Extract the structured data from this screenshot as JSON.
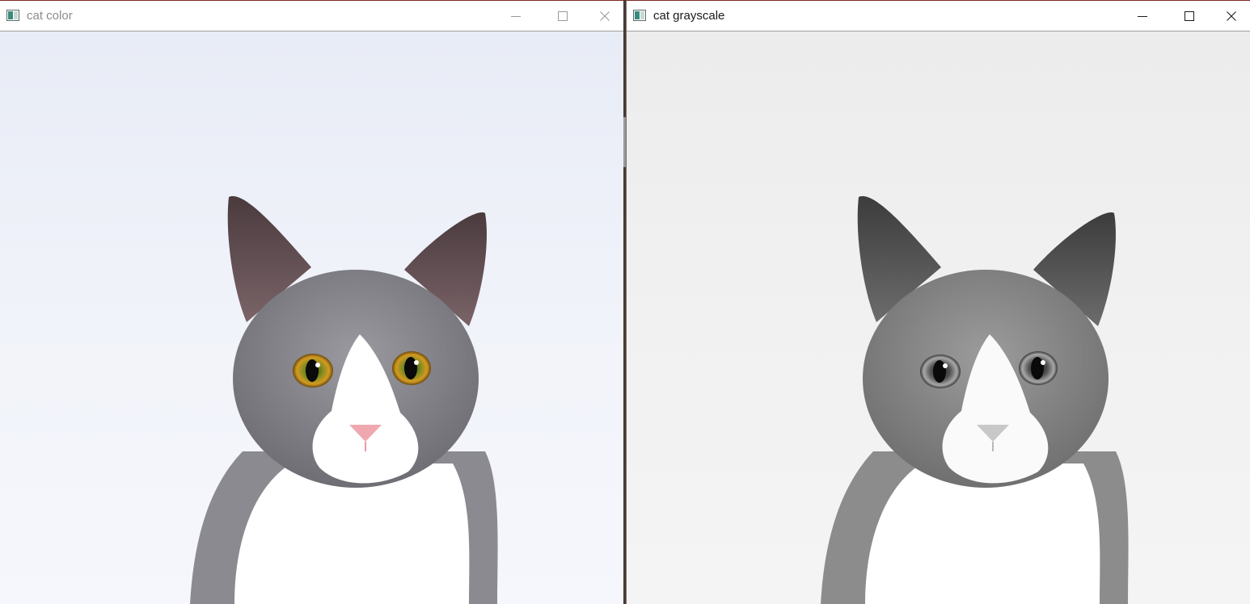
{
  "windows": [
    {
      "title": "cat color",
      "state": "inactive",
      "icon": "opencv-window-icon",
      "controls": [
        "minimize-icon",
        "maximize-icon",
        "close-icon"
      ],
      "image": "color photograph of a grey and white cat with orange-green eyes and pink nose on a pale blue-white background"
    },
    {
      "title": "cat grayscale",
      "state": "active",
      "icon": "opencv-window-icon",
      "controls": [
        "minimize-icon",
        "maximize-icon",
        "close-icon"
      ],
      "image": "grayscale version of the same cat photograph"
    }
  ],
  "colors": {
    "titlebar_bg": "#ffffff",
    "inactive_title": "#8c8c8c",
    "active_title": "#1a1a1a",
    "color_bg": "#eef1f8",
    "gray_bg": "#efefef"
  }
}
